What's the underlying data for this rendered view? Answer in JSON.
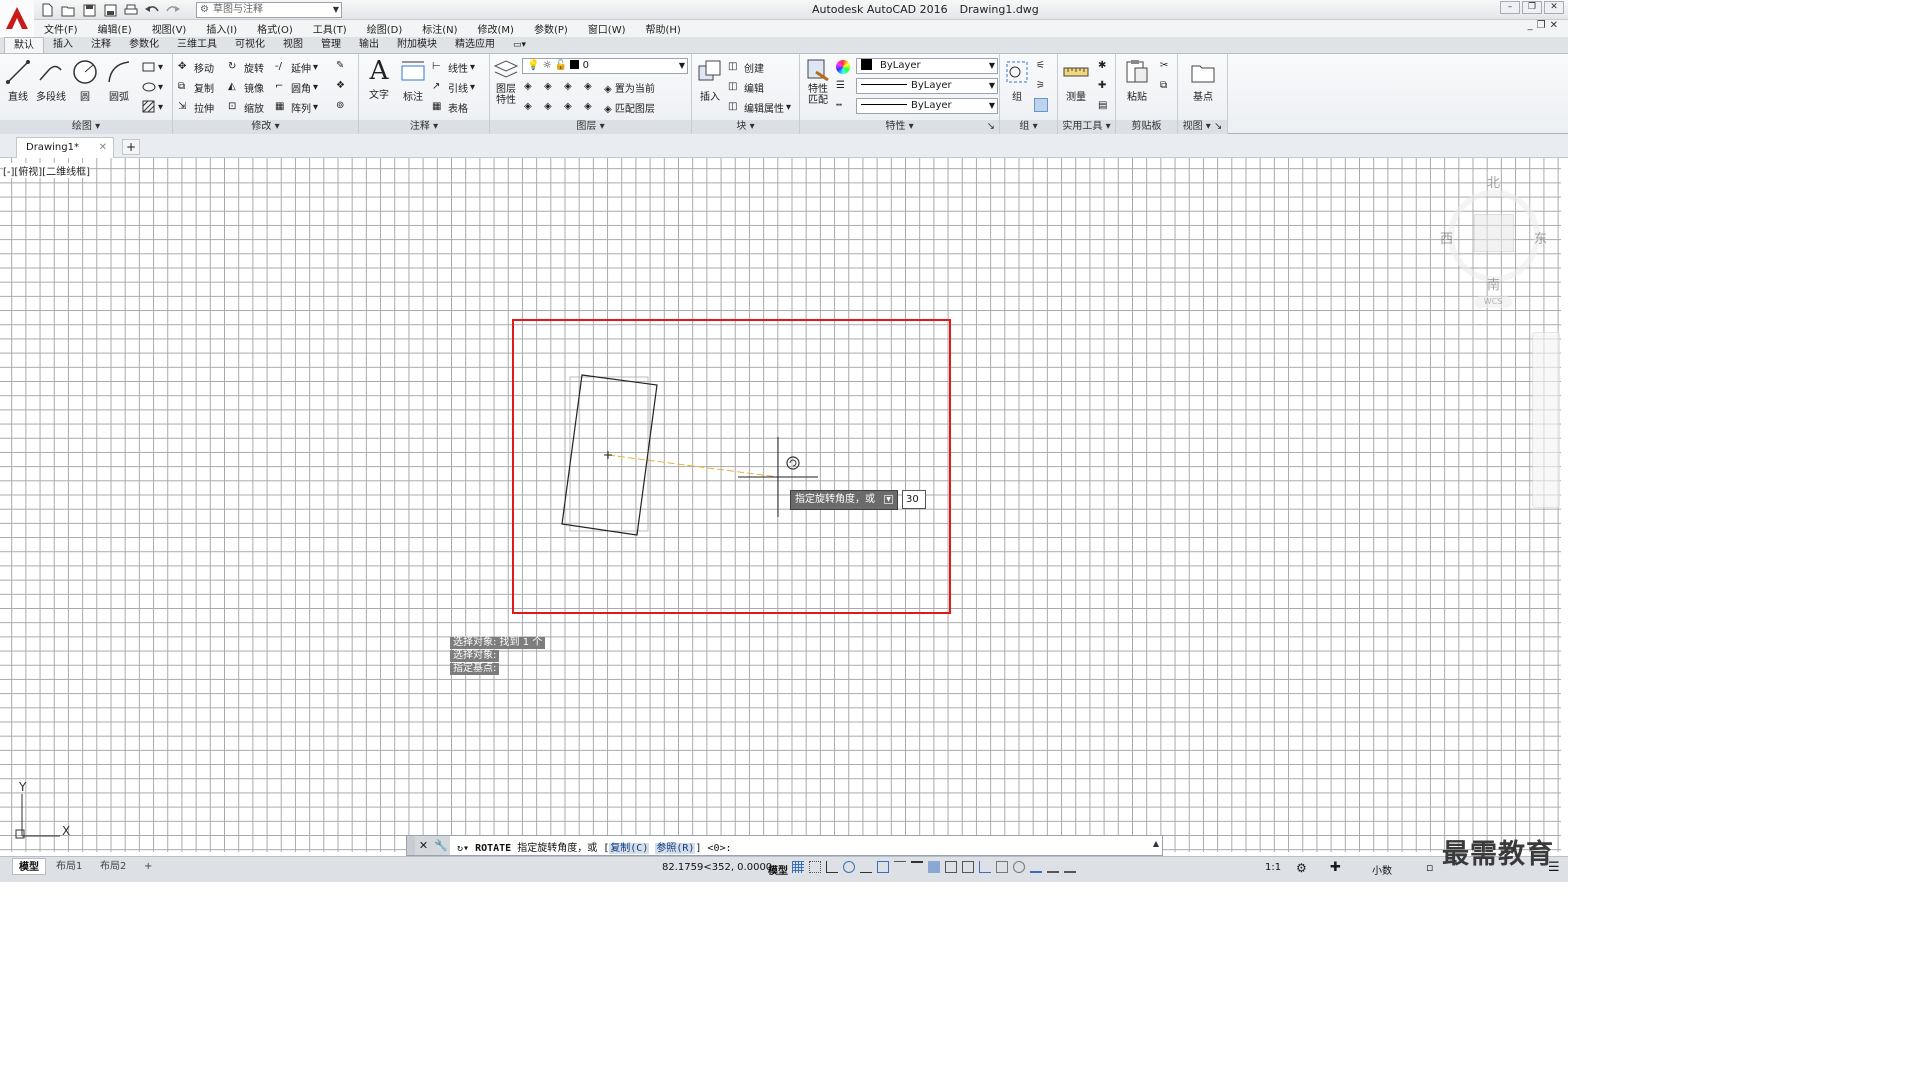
{
  "app": {
    "title": "Autodesk AutoCAD 2016",
    "document": "Drawing1.dwg",
    "workspace": "草图与注释"
  },
  "menu": [
    "文件(F)",
    "编辑(E)",
    "视图(V)",
    "插入(I)",
    "格式(O)",
    "工具(T)",
    "绘图(D)",
    "标注(N)",
    "修改(M)",
    "参数(P)",
    "窗口(W)",
    "帮助(H)"
  ],
  "ribbon_tabs": [
    "默认",
    "插入",
    "注释",
    "参数化",
    "三维工具",
    "可视化",
    "视图",
    "管理",
    "输出",
    "附加模块",
    "精选应用"
  ],
  "panels": {
    "draw": {
      "title": "绘图",
      "line": "直线",
      "polyline": "多段线",
      "circle": "圆",
      "arc": "圆弧"
    },
    "modify": {
      "title": "修改",
      "move": "移动",
      "rotate": "旋转",
      "trim": "延伸",
      "copy": "复制",
      "mirror": "镜像",
      "fillet": "圆角",
      "stretch": "拉伸",
      "scale": "缩放",
      "array": "阵列"
    },
    "annotation": {
      "title": "注释",
      "text": "文字",
      "dimension": "标注",
      "linear": "线性",
      "leader": "引线",
      "table": "表格"
    },
    "layers": {
      "title": "图层",
      "properties_l1": "图层",
      "properties_l2": "特性",
      "current_layer": "0",
      "set_current": "置为当前",
      "match_layer": "匹配图层"
    },
    "block": {
      "title": "块",
      "insert": "插入",
      "create": "创建",
      "edit": "编辑",
      "edit_attr": "编辑属性"
    },
    "properties": {
      "title": "特性",
      "match_l1": "特性",
      "match_l2": "匹配",
      "color": "ByLayer",
      "linetype": "ByLayer",
      "lineweight": "ByLayer"
    },
    "groups": {
      "title": "组",
      "group": "组"
    },
    "utilities": {
      "title": "实用工具",
      "measure": "测量"
    },
    "clipboard": {
      "title": "剪贴板",
      "paste": "粘贴"
    },
    "view": {
      "title": "视图",
      "base": "基点"
    }
  },
  "file_tab": "Drawing1*",
  "viewport_label": "[-][俯视][二维线框]",
  "viewcube": {
    "north": "北",
    "south": "南",
    "east": "东",
    "west": "西",
    "wcs": "WCS"
  },
  "ucs": {
    "x": "X",
    "y": "Y"
  },
  "tooltip": {
    "prompt": "指定旋转角度，或",
    "value": "30"
  },
  "history": [
    "选择对象: 找到 1 个",
    "选择对象:",
    "指定基点:"
  ],
  "command": {
    "name": "ROTATE",
    "prompt": "指定旋转角度，或 [",
    "opt1": "复制(C)",
    "opt2": "参照(R)",
    "suffix": "] <0>:"
  },
  "status": {
    "layouts": [
      "模型",
      "布局1",
      "布局2"
    ],
    "coords": "82.1759<352, 0.0000",
    "space": "模型",
    "scale": "1:1",
    "units": "小数"
  },
  "watermark": "最需教育",
  "colors": {
    "highlight_rect": "#e01a1a",
    "rubberband": "#e8b43a",
    "grid": "#a9a9a9"
  }
}
